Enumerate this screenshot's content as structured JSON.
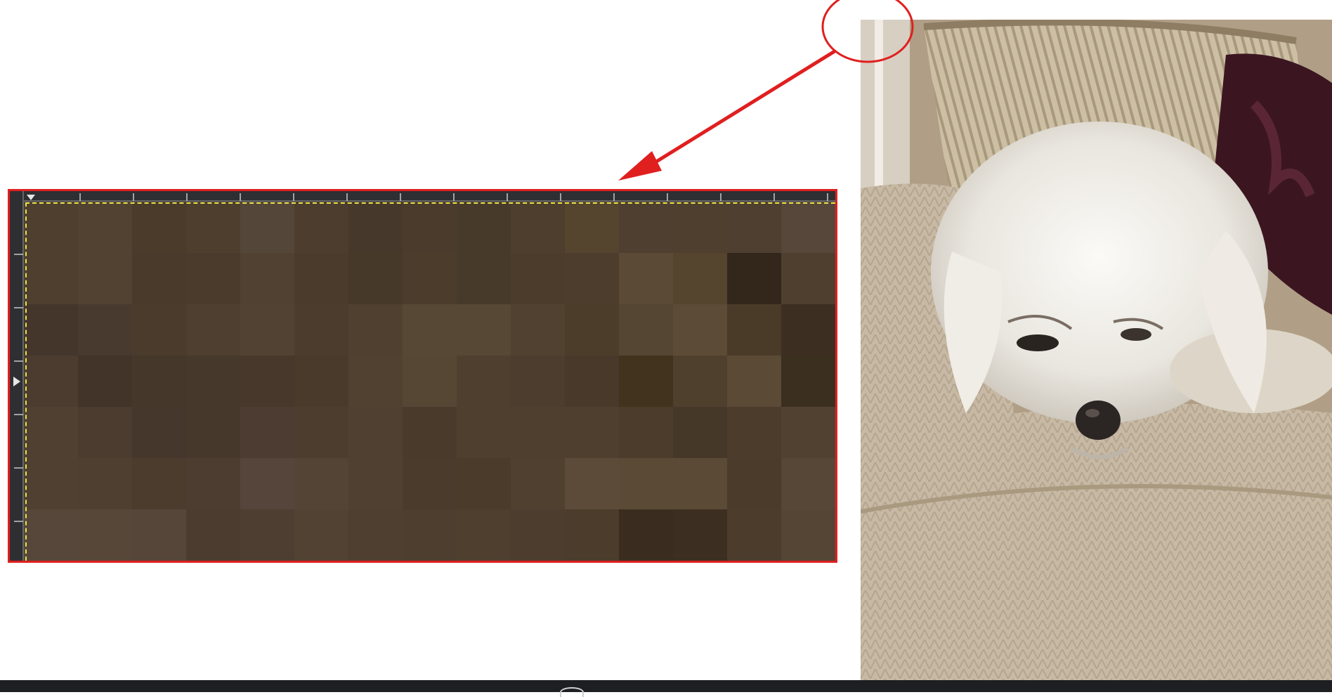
{
  "colors": {
    "highlight": "#e01f1f",
    "selection": "#e8e34a",
    "ruler": "#2e2f33",
    "bottom_bar": "#1e1f22"
  },
  "icons": {
    "zoom_source": "circle-marker",
    "pointer": "arrow",
    "bottom_control": "half-circle-icon"
  },
  "zoom_view": {
    "pixel_grid": [
      [
        "#4f3f2f",
        "#524232",
        "#4a3b2b",
        "#4d3e2e",
        "#55463a",
        "#4c3d2e",
        "#46382a",
        "#4b3b2c",
        "#473a2b",
        "#4d3e2d",
        "#55452f",
        "#4f3f30",
        "#4f3f2f",
        "#4e3f30",
        "#56473a"
      ],
      [
        "#4f3f2f",
        "#524232",
        "#493a2b",
        "#4a3b2c",
        "#514132",
        "#4a3b2c",
        "#46392a",
        "#4b3c2c",
        "#473a2b",
        "#4b3c2c",
        "#4c3d2d",
        "#5a4a36",
        "#55452f",
        "#33271b",
        "#4e3f2f"
      ],
      [
        "#44362b",
        "#483a2e",
        "#4a3b2d",
        "#4e3f30",
        "#524233",
        "#4b3c2e",
        "#4f4030",
        "#574836",
        "#574836",
        "#514130",
        "#4c3d2b",
        "#554533",
        "#5c4b36",
        "#4a3b29",
        "#3c2f22"
      ],
      [
        "#4b3c2f",
        "#433429",
        "#46372b",
        "#47382c",
        "#47382b",
        "#493a2c",
        "#514131",
        "#564634",
        "#4f3f2f",
        "#4c3d2e",
        "#48392b",
        "#42331f",
        "#4f402e",
        "#5a4a36",
        "#3b2f1f"
      ],
      [
        "#4f4031",
        "#4b3c2f",
        "#46372c",
        "#47382c",
        "#4c3c31",
        "#4c3d2f",
        "#504031",
        "#493a2c",
        "#4f3f2f",
        "#4f3f2f",
        "#4f3f2e",
        "#4b3c2c",
        "#463829",
        "#4c3c2c",
        "#504131"
      ],
      [
        "#4f4031",
        "#4e3f31",
        "#4c3c2e",
        "#4d3d31",
        "#55453a",
        "#544436",
        "#504031",
        "#4a3b2c",
        "#4a3b2a",
        "#504030",
        "#5b4b38",
        "#5a4a36",
        "#5a4a36",
        "#4a3b2a",
        "#564737"
      ],
      [
        "#56473a",
        "#574739",
        "#56463a",
        "#4b3c2f",
        "#4d3e31",
        "#524233",
        "#4f3f30",
        "#4d3e2f",
        "#4f3f2f",
        "#4d3d2e",
        "#4b3c2b",
        "#3a2d1f",
        "#3c2e20",
        "#4b3c2c",
        "#544535"
      ]
    ]
  }
}
